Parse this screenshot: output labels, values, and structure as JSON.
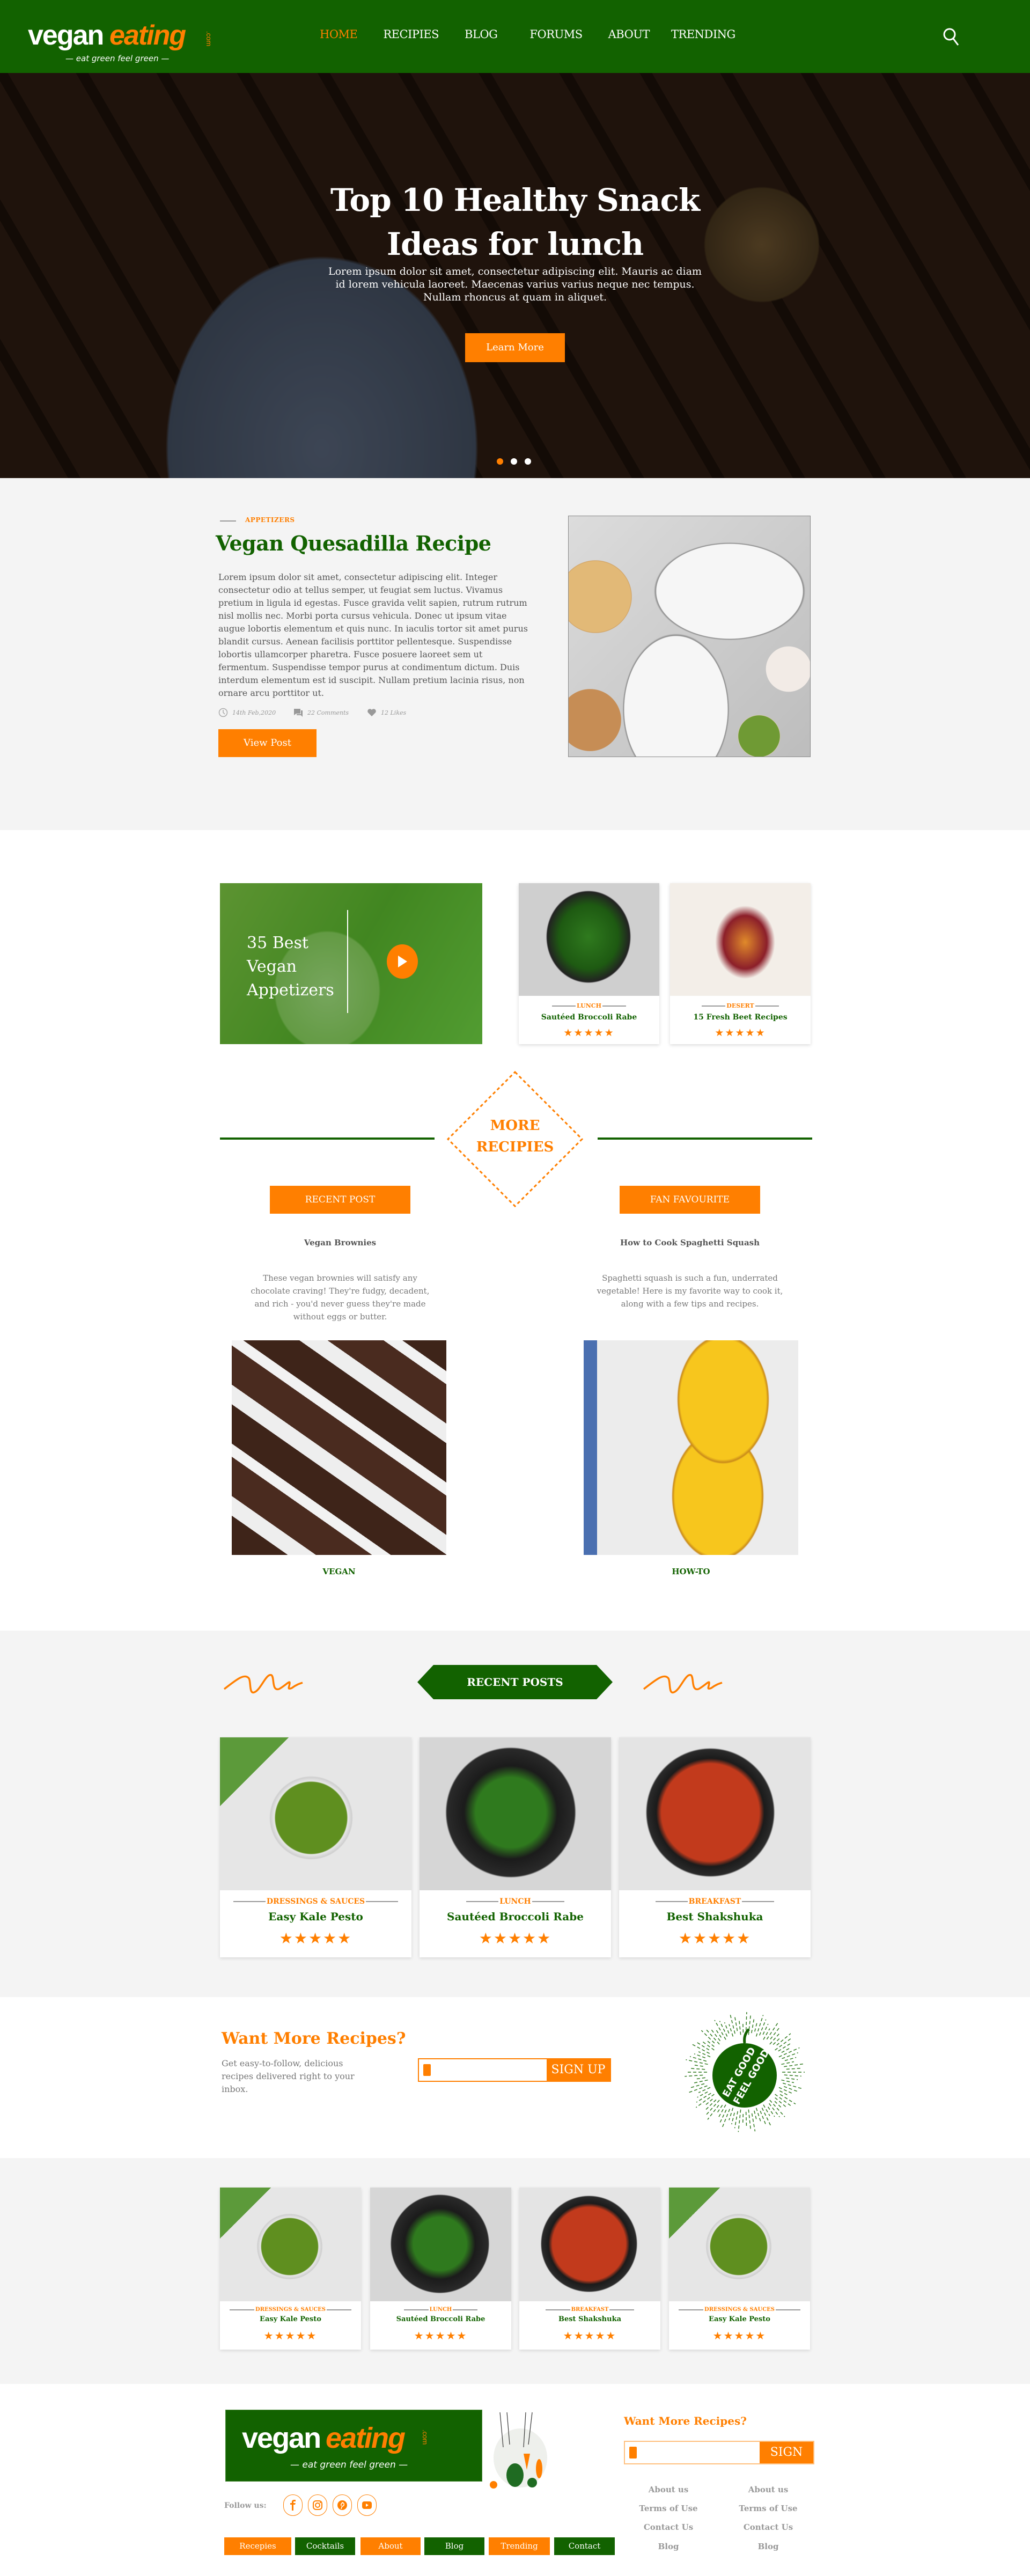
{
  "brand": {
    "name_part1": "vegan",
    "name_part2": "eating",
    "tld": ".com",
    "tagline": "— eat green feel green —"
  },
  "colors": {
    "primary_green": "#126200",
    "accent_orange": "#ff7f00",
    "section_gray": "#f4f4f4"
  },
  "nav": {
    "items": [
      {
        "label": "HOME",
        "active": true
      },
      {
        "label": "RECIPIES",
        "active": false
      },
      {
        "label": "BLOG",
        "active": false
      },
      {
        "label": "FORUMS",
        "active": false
      },
      {
        "label": "ABOUT",
        "active": false
      },
      {
        "label": "TRENDING",
        "active": false
      }
    ],
    "search_icon": "search-icon"
  },
  "hero": {
    "title": "Top 10 Healthy Snack Ideas for lunch",
    "text": "Lorem ipsum dolor sit amet, consectetur adipiscing elit. Mauris ac diam id lorem vehicula laoreet. Maecenas varius varius neque nec tempus. Nullam rhoncus at quam in aliquet.",
    "button": "Learn More",
    "slides": 3,
    "active_slide": 1
  },
  "featured": {
    "category": "APPETIZERS",
    "title": "Vegan Quesadilla Recipe",
    "text": "Lorem ipsum dolor sit amet, consectetur adipiscing elit. Integer consectetur odio at tellus semper, ut feugiat sem luctus. Vivamus pretium in ligula id egestas. Fusce gravida velit sapien, rutrum rutrum nisl mollis nec. Morbi porta cursus vehicula. Donec ut ipsum vitae augue lobortis elementum et quis nunc. In iaculis tortor sit amet purus blandit cursus. Aenean facilisis porttitor pellentesque. Suspendisse lobortis ullamcorper pharetra. Fusce posuere laoreet sem ut fermentum. Suspendisse tempor purus at condimentum dictum. Duis interdum elementum est id suscipit. Nullam pretium lacinia risus, non ornare arcu porttitor ut.",
    "date": "14th Feb,2020",
    "comments": "22 Comments",
    "likes": "12 Likes",
    "button": "View Post"
  },
  "appetizers": {
    "video_title": "35 Best Vegan Appetizers",
    "cards": [
      {
        "category": "LUNCH",
        "title": "Sautéed Broccoli Rabe",
        "rating": 5
      },
      {
        "category": "DESERT",
        "title": "15 Fresh Beet Recipes",
        "rating": 5
      }
    ]
  },
  "more_recipes": {
    "title_line1": "MORE",
    "title_line2": "RECIPIES",
    "columns": [
      {
        "tag": "RECENT POST",
        "heading": "Vegan Brownies",
        "description": "These vegan brownies will satisfy any chocolate craving! They're fudgy, decadent, and rich - you'd never guess they're made without eggs or butter.",
        "category": "VEGAN"
      },
      {
        "tag": "FAN FAVOURITE",
        "heading": "How to Cook Spaghetti Squash",
        "description": "Spaghetti squash is such a fun, underrated vegetable! Here is my favorite way to cook it, along with a few tips and recipes.",
        "category": "HOW-TO"
      }
    ]
  },
  "recent_posts": {
    "title": "RECENT POSTS",
    "cards": [
      {
        "category": "DRESSINGS & SAUCES",
        "title": "Easy Kale Pesto",
        "rating": 5
      },
      {
        "category": "LUNCH",
        "title": "Sautéed Broccoli Rabe",
        "rating": 5
      },
      {
        "category": "BREAKFAST",
        "title": "Best Shakshuka",
        "rating": 5
      }
    ]
  },
  "newsletter": {
    "title": "Want More Recipes?",
    "text": "Get easy-to-follow, delicious recipes delivered right to your inbox.",
    "email_value": "",
    "button": "SIGN UP",
    "badge_text": "EAT GOOD FEEL GOOD"
  },
  "more_cards": {
    "cards": [
      {
        "category": "DRESSINGS & SAUCES",
        "title": "Easy Kale Pesto",
        "rating": 5
      },
      {
        "category": "LUNCH",
        "title": "Sautéed Broccoli Rabe",
        "rating": 5
      },
      {
        "category": "BREAKFAST",
        "title": "Best Shakshuka",
        "rating": 5
      },
      {
        "category": "DRESSINGS & SAUCES",
        "title": "Easy Kale Pesto",
        "rating": 5
      }
    ]
  },
  "footer": {
    "follow_label": "Follow us:",
    "social": [
      "facebook-icon",
      "instagram-icon",
      "pinterest-icon",
      "youtube-icon"
    ],
    "tabs": [
      {
        "label": "Recepies",
        "color": "orange"
      },
      {
        "label": "Cocktails",
        "color": "green"
      },
      {
        "label": "About",
        "color": "orange"
      },
      {
        "label": "Blog",
        "color": "green"
      },
      {
        "label": "Trending",
        "color": "orange"
      },
      {
        "label": "Contact",
        "color": "green"
      }
    ],
    "newsletter_title": "Want More Recipes?",
    "newsletter_button": "SIGN UP",
    "links_col1": [
      "About us",
      "Terms of Use",
      "Contact Us",
      "Blog"
    ],
    "links_col2": [
      "About us",
      "Terms of Use",
      "Contact Us",
      "Blog"
    ]
  }
}
